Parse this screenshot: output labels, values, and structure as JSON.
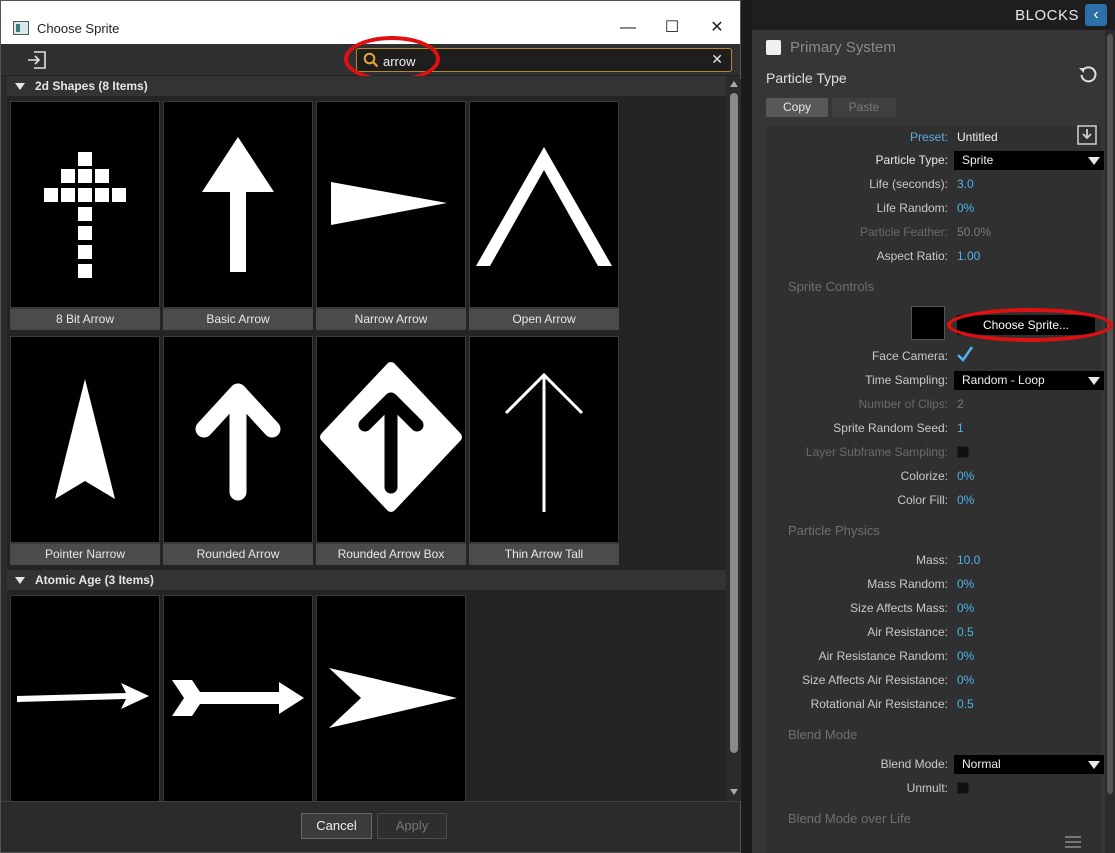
{
  "dialog": {
    "title": "Choose Sprite",
    "search": {
      "value": "arrow"
    },
    "categories": [
      {
        "title": "2d Shapes (8 Items)",
        "items": [
          "8 Bit Arrow",
          "Basic Arrow",
          "Narrow Arrow",
          "Open Arrow",
          "Pointer Narrow",
          "Rounded Arrow",
          "Rounded Arrow Box",
          "Thin Arrow Tall"
        ]
      },
      {
        "title": "Atomic Age (3 Items)",
        "items": [
          "",
          "",
          ""
        ]
      }
    ],
    "buttons": {
      "cancel": "Cancel",
      "apply": "Apply"
    },
    "window_controls": {
      "minimize": "—",
      "maximize": "☐",
      "close": "✕"
    }
  },
  "panel": {
    "header": "BLOCKS",
    "system_title": "Primary System",
    "section_title": "Particle Type",
    "copy_label": "Copy",
    "paste_label": "Paste",
    "preset": {
      "label": "Preset:",
      "value": "Untitled"
    },
    "particle_type": {
      "label": "Particle Type:",
      "value": "Sprite"
    },
    "life": {
      "label": "Life (seconds):",
      "value": "3.0"
    },
    "life_random": {
      "label": "Life Random:",
      "value": "0%"
    },
    "particle_feather": {
      "label": "Particle Feather:",
      "value": "50.0%"
    },
    "aspect_ratio": {
      "label": "Aspect Ratio:",
      "value": "1.00"
    },
    "sprite_controls_title": "Sprite Controls",
    "choose_sprite_label": "Choose Sprite...",
    "face_camera": {
      "label": "Face Camera:",
      "checked": true
    },
    "time_sampling": {
      "label": "Time Sampling:",
      "value": "Random - Loop"
    },
    "number_of_clips": {
      "label": "Number of Clips:",
      "value": "2"
    },
    "sprite_random_seed": {
      "label": "Sprite Random Seed:",
      "value": "1"
    },
    "layer_subframe_sampling": {
      "label": "Layer Subframe Sampling:",
      "checked": false
    },
    "colorize": {
      "label": "Colorize:",
      "value": "0%"
    },
    "color_fill": {
      "label": "Color Fill:",
      "value": "0%"
    },
    "physics_title": "Particle Physics",
    "mass": {
      "label": "Mass:",
      "value": "10.0"
    },
    "mass_random": {
      "label": "Mass Random:",
      "value": "0%"
    },
    "size_affects_mass": {
      "label": "Size Affects Mass:",
      "value": "0%"
    },
    "air_resistance": {
      "label": "Air Resistance:",
      "value": "0.5"
    },
    "air_resistance_random": {
      "label": "Air Resistance Random:",
      "value": "0%"
    },
    "size_affects_air_resistance": {
      "label": "Size Affects Air Resistance:",
      "value": "0%"
    },
    "rotational_air_resistance": {
      "label": "Rotational Air Resistance:",
      "value": "0.5"
    },
    "blend_mode_title": "Blend Mode",
    "blend_mode": {
      "label": "Blend Mode:",
      "value": "Normal"
    },
    "unmult": {
      "label": "Unmult:",
      "checked": false
    },
    "blend_mode_over_life_title": "Blend Mode over Life"
  },
  "colors": {
    "accent_blue": "#4fb2e8",
    "highlight_red": "#e01010",
    "search_border": "#b8862c"
  }
}
